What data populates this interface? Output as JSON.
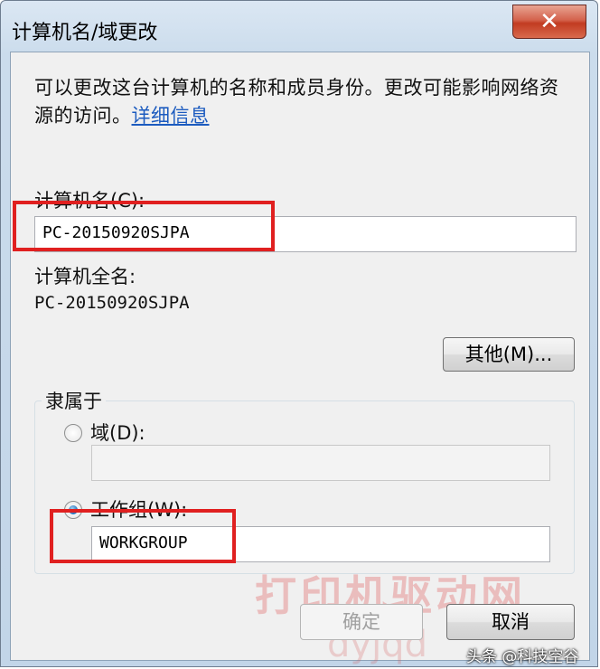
{
  "window": {
    "title": "计算机名/域更改",
    "close_glyph": "✕"
  },
  "description": {
    "text": "可以更改这台计算机的名称和成员身份。更改可能影响网络资源的访问。",
    "link": "详细信息"
  },
  "computer_name": {
    "label": "计算机名(C):",
    "value": "PC-20150920SJPA"
  },
  "full_name": {
    "label": "计算机全名:",
    "value": "PC-20150920SJPA"
  },
  "other_button": "其他(M)...",
  "member_of": {
    "legend": "隶属于",
    "domain": {
      "label": "域(D):",
      "value": "",
      "checked": false
    },
    "workgroup": {
      "label": "工作组(W):",
      "value": "WORKGROUP",
      "checked": true
    }
  },
  "buttons": {
    "ok": "确定",
    "cancel": "取消"
  },
  "watermark": {
    "text": "打印机驱动网",
    "url": "dyjqd"
  },
  "credit": "头条 @科技空谷",
  "colors": {
    "highlight": "#e02020",
    "link": "#1c5bbf",
    "close_button": "#c23b21"
  }
}
